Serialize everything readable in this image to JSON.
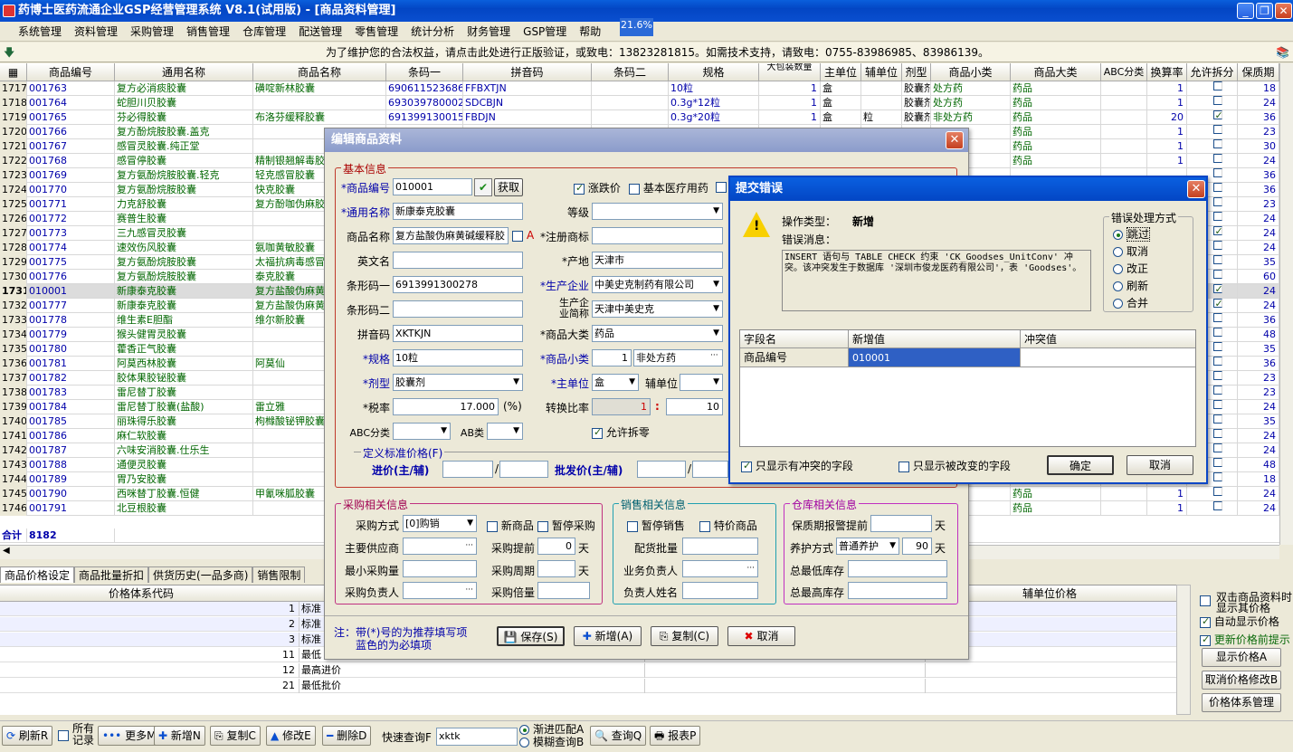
{
  "window": {
    "title": "药博士医药流通企业GSP经营管理系统 V8.1(试用版) - [商品资料管理]"
  },
  "memory": "21.6%",
  "menu": [
    "系统管理",
    "资料管理",
    "采购管理",
    "销售管理",
    "仓库管理",
    "配送管理",
    "零售管理",
    "统计分析",
    "财务管理",
    "GSP管理",
    "帮助"
  ],
  "notice": "为了维护您的合法权益，请点击此处进行正版验证，或致电：13823281815。如需技术支持，请致电：0755-83986985、83986139。",
  "grid": {
    "headers": [
      "商品编号",
      "通用名称",
      "商品名称",
      "条码一",
      "拼音码",
      "条码二",
      "规格",
      "大包装数量",
      "主单位",
      "辅单位",
      "剂型",
      "商品小类",
      "商品大类",
      "ABC分类",
      "换算率",
      "允许拆分",
      "保质期"
    ],
    "rows": [
      {
        "n": "1717",
        "code": "001763",
        "generic": "复方必消痰胶囊",
        "name": "磺啶新林胶囊",
        "bar1": "6906115236867",
        "py": "FFBXTJN",
        "spec": "10粒",
        "pack": "1",
        "unit": "盒",
        "unit2": "",
        "form": "胶囊剂",
        "cat": "处方药",
        "big": "药品",
        "rate": "1",
        "split": false,
        "shelf": "18"
      },
      {
        "n": "1718",
        "code": "001764",
        "generic": "蛇胆川贝胶囊",
        "name": "",
        "bar1": "6930397800027",
        "py": "SDCBJN",
        "spec": "0.3g*12粒",
        "pack": "1",
        "unit": "盒",
        "unit2": "",
        "form": "胶囊剂",
        "cat": "处方药",
        "big": "药品",
        "rate": "1",
        "split": false,
        "shelf": "24"
      },
      {
        "n": "1719",
        "code": "001765",
        "generic": "芬必得胶囊",
        "name": "布洛芬缓释胶囊",
        "bar1": "6913991300155",
        "py": "FBDJN",
        "spec": "0.3g*20粒",
        "pack": "1",
        "unit": "盒",
        "unit2": "粒",
        "form": "胶囊剂",
        "cat": "非处方药",
        "big": "药品",
        "rate": "20",
        "split": true,
        "shelf": "36"
      },
      {
        "n": "1720",
        "code": "001766",
        "generic": "复方酚烷胺胶囊.盖克",
        "name": "",
        "bar1": "",
        "py": "",
        "spec": "",
        "pack": "",
        "unit": "",
        "unit2": "",
        "form": "",
        "cat": "",
        "big": "药品",
        "rate": "1",
        "split": false,
        "shelf": "23"
      },
      {
        "n": "1721",
        "code": "001767",
        "generic": "感冒灵胶囊.纯正堂",
        "name": "",
        "bar1": "",
        "py": "",
        "spec": "",
        "pack": "",
        "unit": "",
        "unit2": "",
        "form": "",
        "cat": "",
        "big": "药品",
        "rate": "1",
        "split": false,
        "shelf": "30"
      },
      {
        "n": "1722",
        "code": "001768",
        "generic": "感冒停胶囊",
        "name": "精制银翘解毒胶",
        "bar1": "",
        "py": "",
        "spec": "",
        "pack": "",
        "unit": "",
        "unit2": "",
        "form": "",
        "cat": "药",
        "big": "药品",
        "rate": "1",
        "split": false,
        "shelf": "24"
      },
      {
        "n": "1723",
        "code": "001769",
        "generic": "复方氨酚烷胺胶囊.轻克",
        "name": "轻克感冒胶囊",
        "bar1": "",
        "py": "",
        "spec": "",
        "pack": "",
        "unit": "",
        "unit2": "",
        "form": "",
        "cat": "药",
        "big": "",
        "rate": "",
        "split": false,
        "shelf": "36"
      },
      {
        "n": "1724",
        "code": "001770",
        "generic": "复方氨酚烷胺胶囊",
        "name": "快克胶囊",
        "bar1": "",
        "py": "",
        "spec": "",
        "pack": "",
        "unit": "",
        "unit2": "",
        "form": "",
        "cat": "",
        "big": "",
        "rate": "",
        "split": false,
        "shelf": "36"
      },
      {
        "n": "1725",
        "code": "001771",
        "generic": "力克舒胶囊",
        "name": "复方酚咖伪麻胶",
        "bar1": "",
        "py": "",
        "spec": "",
        "pack": "",
        "unit": "",
        "unit2": "",
        "form": "",
        "cat": "",
        "big": "",
        "rate": "",
        "split": false,
        "shelf": "23"
      },
      {
        "n": "1726",
        "code": "001772",
        "generic": "赛普生胶囊",
        "name": "",
        "bar1": "",
        "py": "",
        "spec": "",
        "pack": "",
        "unit": "",
        "unit2": "",
        "form": "",
        "cat": "",
        "big": "",
        "rate": "",
        "split": false,
        "shelf": "24"
      },
      {
        "n": "1727",
        "code": "001773",
        "generic": "三九感冒灵胶囊",
        "name": "",
        "bar1": "",
        "py": "",
        "spec": "",
        "pack": "",
        "unit": "",
        "unit2": "",
        "form": "",
        "cat": "",
        "big": "",
        "rate": "",
        "split": true,
        "shelf": "24"
      },
      {
        "n": "1728",
        "code": "001774",
        "generic": "速效伤风胶囊",
        "name": "氨咖黄敏胶囊",
        "bar1": "",
        "py": "",
        "spec": "",
        "pack": "",
        "unit": "",
        "unit2": "",
        "form": "",
        "cat": "",
        "big": "",
        "rate": "",
        "split": false,
        "shelf": "24"
      },
      {
        "n": "1729",
        "code": "001775",
        "generic": "复方氨酚烷胺胶囊",
        "name": "太福抗病毒感冒",
        "bar1": "",
        "py": "",
        "spec": "",
        "pack": "",
        "unit": "",
        "unit2": "",
        "form": "",
        "cat": "",
        "big": "",
        "rate": "",
        "split": false,
        "shelf": "35"
      },
      {
        "n": "1730",
        "code": "001776",
        "generic": "复方氨酚烷胺胶囊",
        "name": "泰克胶囊",
        "bar1": "",
        "py": "",
        "spec": "",
        "pack": "",
        "unit": "",
        "unit2": "",
        "form": "",
        "cat": "",
        "big": "",
        "rate": "",
        "split": false,
        "shelf": "60"
      },
      {
        "n": "1731",
        "code": "010001",
        "generic": "新康泰克胶囊",
        "name": "复方盐酸伪麻黄",
        "bar1": "",
        "py": "",
        "spec": "",
        "pack": "",
        "unit": "",
        "unit2": "",
        "form": "",
        "cat": "",
        "big": "",
        "rate": "",
        "split": true,
        "shelf": "24",
        "selected": true
      },
      {
        "n": "1732",
        "code": "001777",
        "generic": "新康泰克胶囊",
        "name": "复方盐酸伪麻黄",
        "bar1": "",
        "py": "",
        "spec": "",
        "pack": "",
        "unit": "",
        "unit2": "",
        "form": "",
        "cat": "",
        "big": "",
        "rate": "",
        "split": true,
        "shelf": "24"
      },
      {
        "n": "1733",
        "code": "001778",
        "generic": "维生素E胆酯",
        "name": "维尔新胶囊",
        "bar1": "",
        "py": "",
        "spec": "",
        "pack": "",
        "unit": "",
        "unit2": "",
        "form": "",
        "cat": "",
        "big": "",
        "rate": "",
        "split": false,
        "shelf": "36"
      },
      {
        "n": "1734",
        "code": "001779",
        "generic": "猴头健胃灵胶囊",
        "name": "",
        "bar1": "",
        "py": "",
        "spec": "",
        "pack": "",
        "unit": "",
        "unit2": "",
        "form": "",
        "cat": "",
        "big": "",
        "rate": "",
        "split": false,
        "shelf": "48"
      },
      {
        "n": "1735",
        "code": "001780",
        "generic": "藿香正气胶囊",
        "name": "",
        "bar1": "",
        "py": "",
        "spec": "",
        "pack": "",
        "unit": "",
        "unit2": "",
        "form": "",
        "cat": "",
        "big": "",
        "rate": "",
        "split": false,
        "shelf": "35"
      },
      {
        "n": "1736",
        "code": "001781",
        "generic": "阿莫西林胶囊",
        "name": "阿莫仙",
        "bar1": "",
        "py": "",
        "spec": "",
        "pack": "",
        "unit": "",
        "unit2": "",
        "form": "",
        "cat": "",
        "big": "",
        "rate": "",
        "split": false,
        "shelf": "36"
      },
      {
        "n": "1737",
        "code": "001782",
        "generic": "胶体果胶铋胶囊",
        "name": "",
        "bar1": "",
        "py": "",
        "spec": "",
        "pack": "",
        "unit": "",
        "unit2": "",
        "form": "",
        "cat": "",
        "big": "",
        "rate": "",
        "split": false,
        "shelf": "23"
      },
      {
        "n": "1738",
        "code": "001783",
        "generic": "雷尼替丁胶囊",
        "name": "",
        "bar1": "",
        "py": "",
        "spec": "",
        "pack": "",
        "unit": "",
        "unit2": "",
        "form": "",
        "cat": "",
        "big": "",
        "rate": "",
        "split": false,
        "shelf": "23"
      },
      {
        "n": "1739",
        "code": "001784",
        "generic": "雷尼替丁胶囊(盐酸)",
        "name": "雷立雅",
        "bar1": "",
        "py": "",
        "spec": "",
        "pack": "",
        "unit": "",
        "unit2": "",
        "form": "",
        "cat": "",
        "big": "",
        "rate": "",
        "split": false,
        "shelf": "24"
      },
      {
        "n": "1740",
        "code": "001785",
        "generic": "丽珠得乐胶囊",
        "name": "枸橼酸铋钾胶囊",
        "bar1": "",
        "py": "",
        "spec": "",
        "pack": "",
        "unit": "",
        "unit2": "",
        "form": "",
        "cat": "",
        "big": "",
        "rate": "",
        "split": false,
        "shelf": "35"
      },
      {
        "n": "1741",
        "code": "001786",
        "generic": "麻仁软胶囊",
        "name": "",
        "bar1": "",
        "py": "",
        "spec": "",
        "pack": "",
        "unit": "",
        "unit2": "",
        "form": "",
        "cat": "",
        "big": "",
        "rate": "",
        "split": false,
        "shelf": "24"
      },
      {
        "n": "1742",
        "code": "001787",
        "generic": "六味安消胶囊.仕乐生",
        "name": "",
        "bar1": "",
        "py": "",
        "spec": "",
        "pack": "",
        "unit": "",
        "unit2": "",
        "form": "",
        "cat": "",
        "big": "",
        "rate": "",
        "split": false,
        "shelf": "24"
      },
      {
        "n": "1743",
        "code": "001788",
        "generic": "通便灵胶囊",
        "name": "",
        "bar1": "",
        "py": "",
        "spec": "",
        "pack": "",
        "unit": "",
        "unit2": "",
        "form": "",
        "cat": "",
        "big": "",
        "rate": "",
        "split": false,
        "shelf": "48"
      },
      {
        "n": "1744",
        "code": "001789",
        "generic": "胃乃安胶囊",
        "name": "",
        "bar1": "",
        "py": "",
        "spec": "",
        "pack": "",
        "unit": "",
        "unit2": "",
        "form": "",
        "cat": "",
        "big": "",
        "rate": "",
        "split": false,
        "shelf": "18"
      },
      {
        "n": "1745",
        "code": "001790",
        "generic": "西咪替丁胶囊.恒健",
        "name": "甲氰咪胍胶囊",
        "bar1": "",
        "py": "",
        "spec": "",
        "pack": "",
        "unit": "",
        "unit2": "",
        "form": "",
        "cat": "药",
        "big": "药品",
        "rate": "1",
        "split": false,
        "shelf": "24"
      },
      {
        "n": "1746",
        "code": "001791",
        "generic": "北豆根胶囊",
        "name": "",
        "bar1": "",
        "py": "",
        "spec": "",
        "pack": "",
        "unit": "",
        "unit2": "",
        "form": "",
        "cat": "药",
        "big": "药品",
        "rate": "1",
        "split": false,
        "shelf": "24"
      }
    ],
    "total_label": "合计",
    "total_value": "8182"
  },
  "tabs": [
    "商品价格设定",
    "商品批量折扣",
    "供货历史(一品多商)",
    "销售限制"
  ],
  "lower": {
    "col1": "价格体系代码",
    "col2": "辅单位价格",
    "rows": [
      {
        "n": "1",
        "t": "标准"
      },
      {
        "n": "2",
        "t": "标准"
      },
      {
        "n": "3",
        "t": "标准"
      },
      {
        "n": "11",
        "t": "最低"
      },
      {
        "n": "12",
        "t": "最高进价"
      },
      {
        "n": "21",
        "t": "最低批价"
      }
    ]
  },
  "rightpanel": {
    "opt1": "双击商品资料时显示其价格",
    "opt2": "自动显示价格",
    "opt3": "更新价格前提示",
    "btn1": "显示价格A",
    "btn2": "取消价格修改B",
    "btn3": "价格体系管理"
  },
  "bottombar": {
    "refresh": "刷新R",
    "all_records": "所有记录",
    "more": "更多M",
    "add": "新增N",
    "copy": "复制C",
    "edit": "修改E",
    "delete": "删除D",
    "quick_label": "快速查询F",
    "quick_value": "xktk",
    "opt_prefix": "渐进匹配A",
    "opt_fuzzy": "模糊查询B",
    "query": "查询Q",
    "report": "报表P"
  },
  "edit": {
    "title": "编辑商品资料",
    "basic_legend": "基本信息",
    "code_label": "*商品编号",
    "code": "010001",
    "get_btn": "获取",
    "chk_price": "涨跌价",
    "chk_medical": "基本医疗用药",
    "generic_label": "*通用名称",
    "generic": "新康泰克胶囊",
    "grade_label": "等级",
    "name_label": "商品名称",
    "name": "复方盐酸伪麻黄碱缓释胶",
    "chk_a": "A",
    "trademark_label": "*注册商标",
    "en_label": "英文名",
    "origin_label": "*产地",
    "origin": "天津市",
    "bar1_label": "条形码一",
    "bar1": "6913991300278",
    "maker_label": "*生产企业",
    "maker": "中美史克制药有限公司",
    "bar2_label": "条形码二",
    "maker_short_label": "生产企业简称",
    "maker_short": "天津中美史克",
    "py_label": "拼音码",
    "py": "XKTKJN",
    "big_label": "*商品大类",
    "big": "药品",
    "spec_label": "*规格",
    "spec": "10粒",
    "small_label": "*商品小类",
    "small_no": "1",
    "small": "非处方药",
    "form_label": "*剂型",
    "form": "胶囊剂",
    "unit_label": "*主单位",
    "unit": "盒",
    "unit2_label": "辅单位",
    "tax_label": "*税率",
    "tax": "17.000",
    "tax_unit": "(%)",
    "rate_label": "转换比率",
    "rate_a": "1",
    "rate_sep": ":",
    "rate_b": "10",
    "abc_label": "ABC分类",
    "ab_label": "AB类",
    "split_label": "允许拆零",
    "price_legend": "定义标准价格(F)",
    "in_price_label": "进价(主/辅)",
    "wholesale_label": "批发价(主/辅)",
    "buy_legend": "采购相关信息",
    "buy_mode_label": "采购方式",
    "buy_mode": "[0]购销",
    "chk_new": "新商品",
    "chk_pause_buy": "暂停采购",
    "supplier_label": "主要供应商",
    "lead_label": "采购提前",
    "lead": "0",
    "lead_unit": "天",
    "minbuy_label": "最小采购量",
    "cycle_label": "采购周期",
    "cycle_unit": "天",
    "buyer_label": "采购负责人",
    "multiple_label": "采购倍量",
    "sale_legend": "销售相关信息",
    "chk_pause_sale": "暂停销售",
    "chk_special": "特价商品",
    "batch_label": "配货批量",
    "salesman_label": "业务负责人",
    "manager_label": "负责人姓名",
    "stock_legend": "仓库相关信息",
    "warn_label": "保质期报警提前",
    "warn_unit": "天",
    "care_label": "养护方式",
    "care": "普通养护",
    "care_days": "90",
    "care_unit": "天",
    "min_stock_label": "总最低库存",
    "max_stock_label": "总最高库存",
    "note1": "注：带(*)号的为推荐填写项",
    "note2": "蓝色的为必填项",
    "save": "保存(S)",
    "new": "新增(A)",
    "copy": "复制(C)",
    "cancel": "取消"
  },
  "error": {
    "title": "提交错误",
    "op_label": "操作类型：",
    "op": "新增",
    "msg_label": "错误消息：",
    "msg": "INSERT 语句与 TABLE CHECK 约束 'CK_Goodses_UnitConv' 冲突。该冲突发生于数据库 '深圳市俊龙医药有限公司'，表 'Goodses'。",
    "mode_legend": "错误处理方式",
    "modes": [
      "跳过",
      "取消",
      "改正",
      "刷新",
      "合并"
    ],
    "cols": [
      "字段名",
      "新增值",
      "冲突值"
    ],
    "row": {
      "field": "商品编号",
      "new": "010001",
      "conflict": ""
    },
    "chk_conflict": "只显示有冲突的字段",
    "chk_changed": "只显示被改变的字段",
    "ok": "确定",
    "cancel": "取消"
  }
}
